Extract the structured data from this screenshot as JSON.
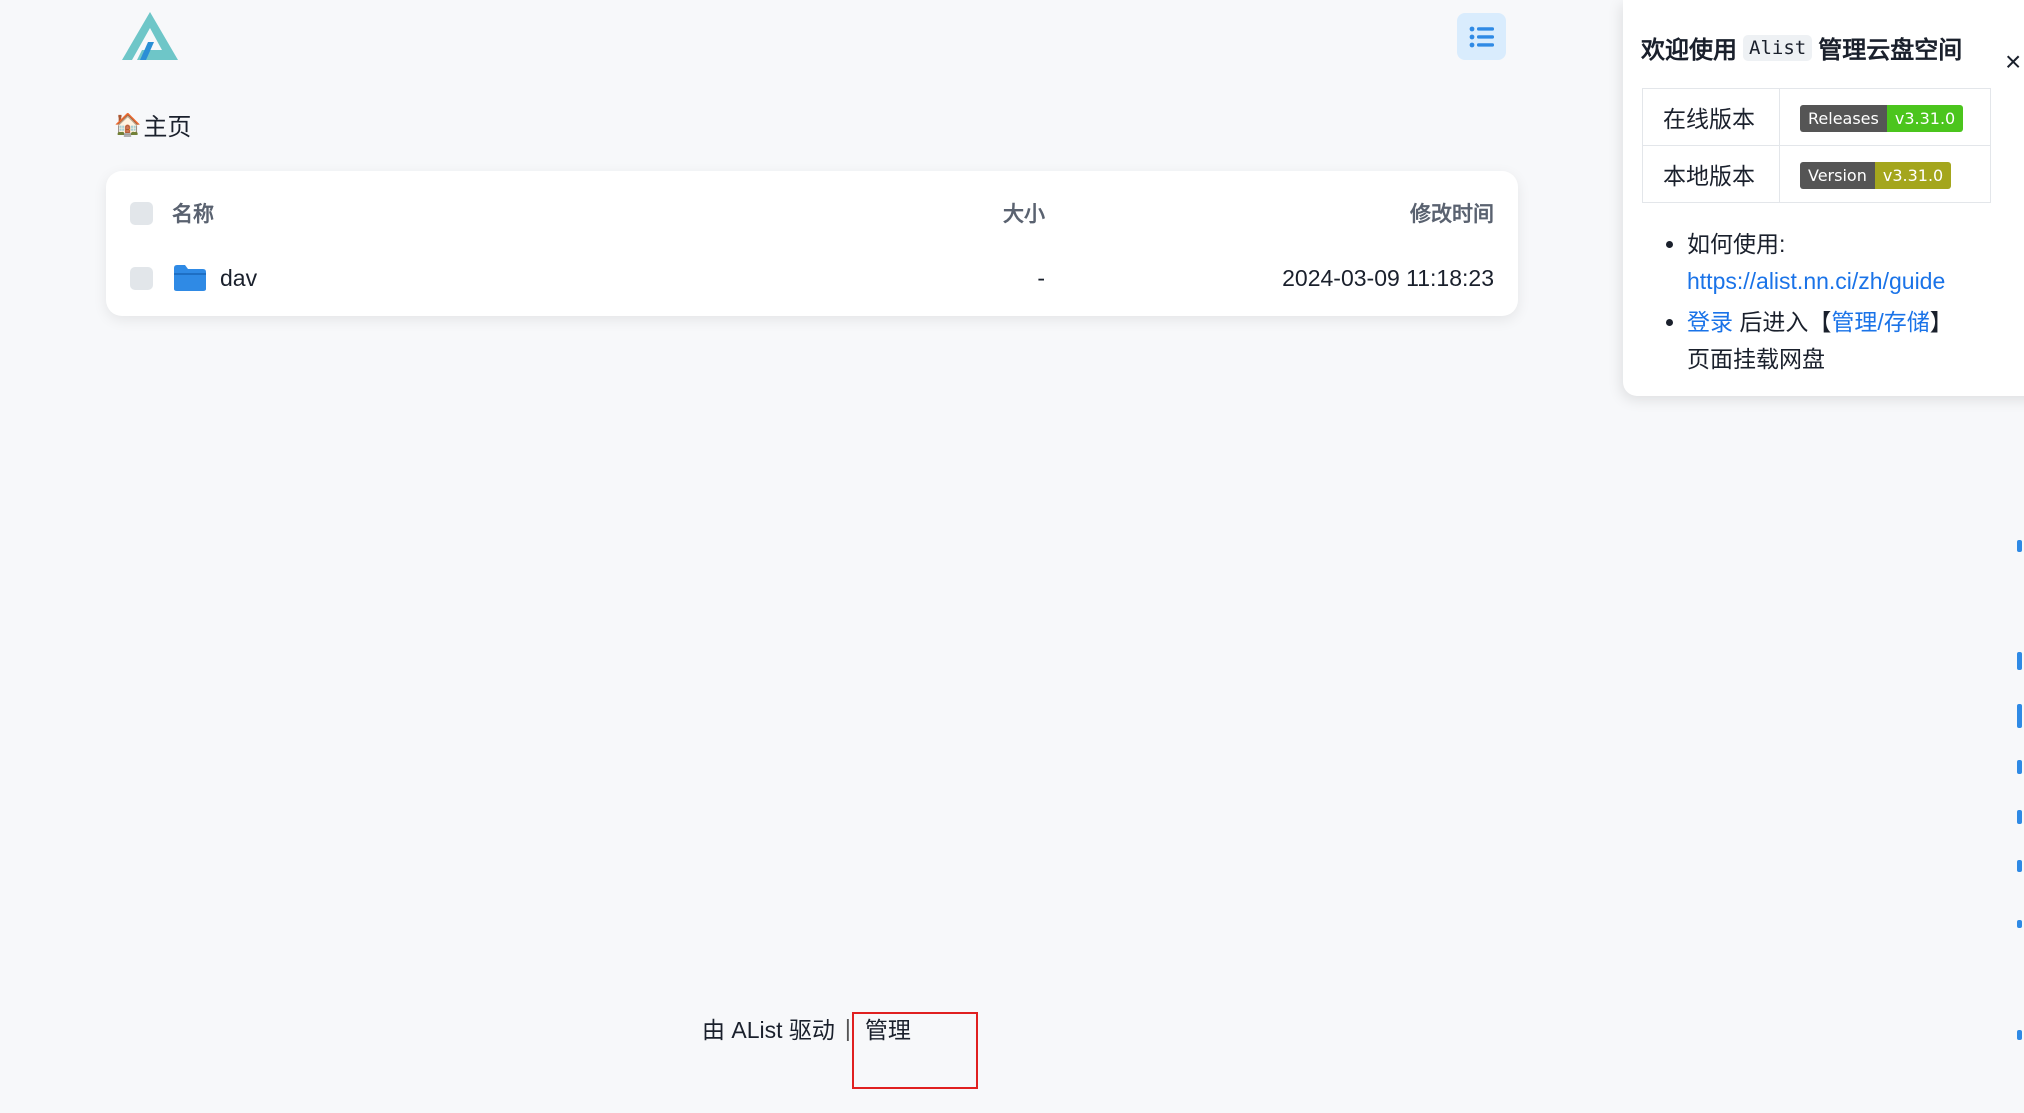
{
  "logo": {
    "icon": "alist-logo-icon"
  },
  "header": {
    "menu_icon": "list-icon"
  },
  "breadcrumb": {
    "home_emoji": "🏠",
    "label": "主页"
  },
  "table": {
    "columns": {
      "name": "名称",
      "size": "大小",
      "modified": "修改时间"
    },
    "rows": [
      {
        "name": "dav",
        "size": "-",
        "modified": "2024-03-09 11:18:23",
        "icon": "folder-icon"
      }
    ]
  },
  "panel": {
    "title_prefix": "欢迎使用",
    "title_code": "Alist",
    "title_suffix": "管理云盘空间",
    "close": "×",
    "versions": [
      {
        "label": "在线版本",
        "badge_left": "Releases",
        "badge_right": "v3.31.0"
      },
      {
        "label": "本地版本",
        "badge_left": "Version",
        "badge_right": "v3.31.0"
      }
    ],
    "tips": {
      "how_to": "如何使用:",
      "guide_url": "https://alist.nn.ci/zh/guide",
      "login": "登录",
      "after": "后进入【",
      "manage_storage": "管理/存储",
      "close_bracket": "】",
      "mount": "页面挂载网盘"
    }
  },
  "footer": {
    "powered": "由 AList 驱动",
    "sep": "|",
    "manage": "管理"
  },
  "colors": {
    "accent": "#1a73e8",
    "highlight": "#e02020",
    "release_badge": "#4bc51d",
    "version_badge": "#a4a61d"
  }
}
